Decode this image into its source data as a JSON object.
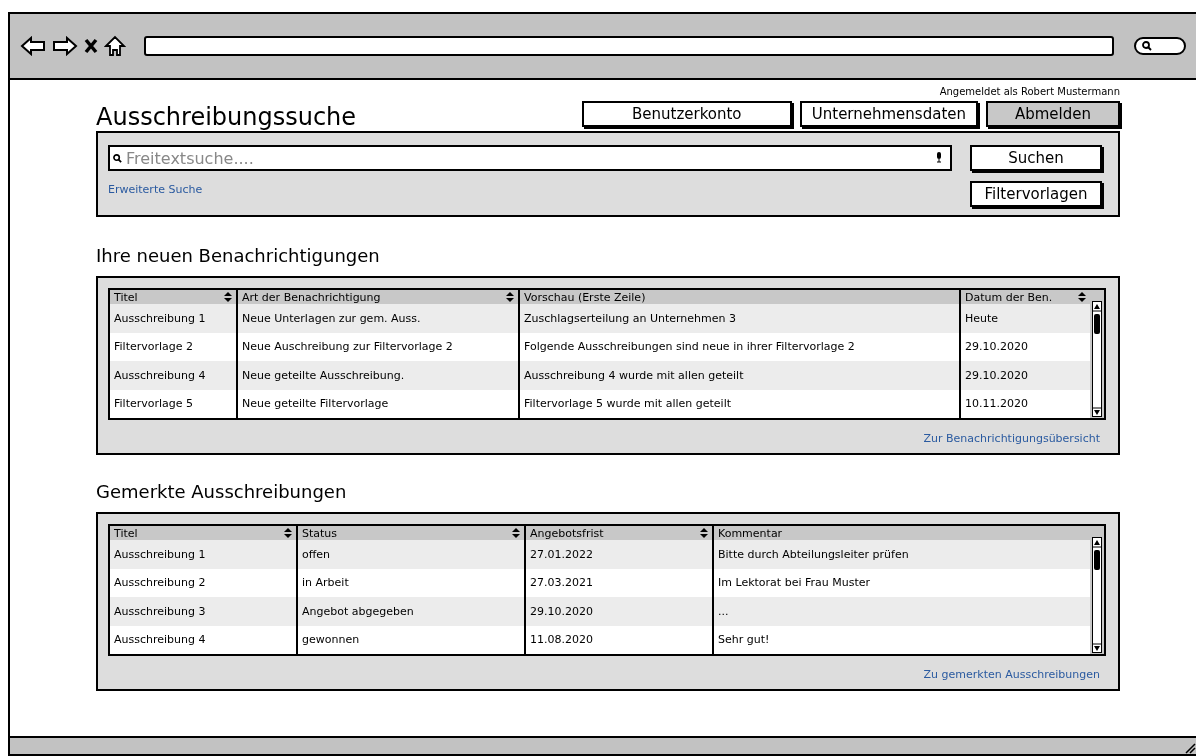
{
  "login_status": "Angemeldet als Robert Mustermann",
  "page_title": "Ausschreibungssuche",
  "header_buttons": [
    {
      "label": "Benutzerkonto",
      "kind": "default"
    },
    {
      "label": "Unternehmensdaten",
      "kind": "default"
    },
    {
      "label": "Abmelden",
      "kind": "primary"
    }
  ],
  "search": {
    "placeholder": "Freitextsuche....",
    "advanced_link": "Erweiterte Suche",
    "buttons": [
      "Suchen",
      "Filtervorlagen"
    ]
  },
  "notifications": {
    "heading": "Ihre neuen Benachrichtigungen",
    "columns": [
      {
        "label": "Titel",
        "sortable": true
      },
      {
        "label": "Art der Benachrichtigung",
        "sortable": true
      },
      {
        "label": "Vorschau (Erste Zeile)",
        "sortable": false
      },
      {
        "label": "Datum der Ben.",
        "sortable": true
      }
    ],
    "rows": [
      [
        "Ausschreibung 1",
        "Neue Unterlagen zur gem. Auss.",
        "Zuschlagserteilung an Unternehmen 3",
        "Heute"
      ],
      [
        "Filtervorlage 2",
        "Neue Auschreibung zur Filtervorlage 2",
        "Folgende Ausschreibungen sind neue in ihrer Filtervorlage 2",
        "29.10.2020"
      ],
      [
        "Ausschreibung 4",
        "Neue geteilte Ausschreibung.",
        "Ausschreibung 4 wurde mit allen geteilt",
        "29.10.2020"
      ],
      [
        "Filtervorlage 5",
        "Neue geteilte Filtervorlage",
        "Filtervorlage 5 wurde mit allen geteilt",
        "10.11.2020"
      ]
    ],
    "link": "Zur Benachrichtigungsübersicht"
  },
  "bookmarks": {
    "heading": "Gemerkte Ausschreibungen",
    "columns": [
      {
        "label": "Titel",
        "sortable": true
      },
      {
        "label": "Status",
        "sortable": true
      },
      {
        "label": "Angebotsfrist",
        "sortable": true
      },
      {
        "label": "Kommentar",
        "sortable": false
      }
    ],
    "rows": [
      [
        "Ausschreibung 1",
        "offen",
        "27.01.2022",
        "Bitte durch Abteilungsleiter prüfen"
      ],
      [
        "Ausschreibung 2",
        "in Arbeit",
        "27.03.2021",
        "Im Lektorat bei Frau Muster"
      ],
      [
        "Ausschreibung 3",
        "Angebot abgegeben",
        "29.10.2020",
        "..."
      ],
      [
        "Ausschreibung 4",
        "gewonnen",
        "11.08.2020",
        "Sehr gut!"
      ]
    ],
    "link": "Zu gemerkten Ausschreibungen"
  }
}
